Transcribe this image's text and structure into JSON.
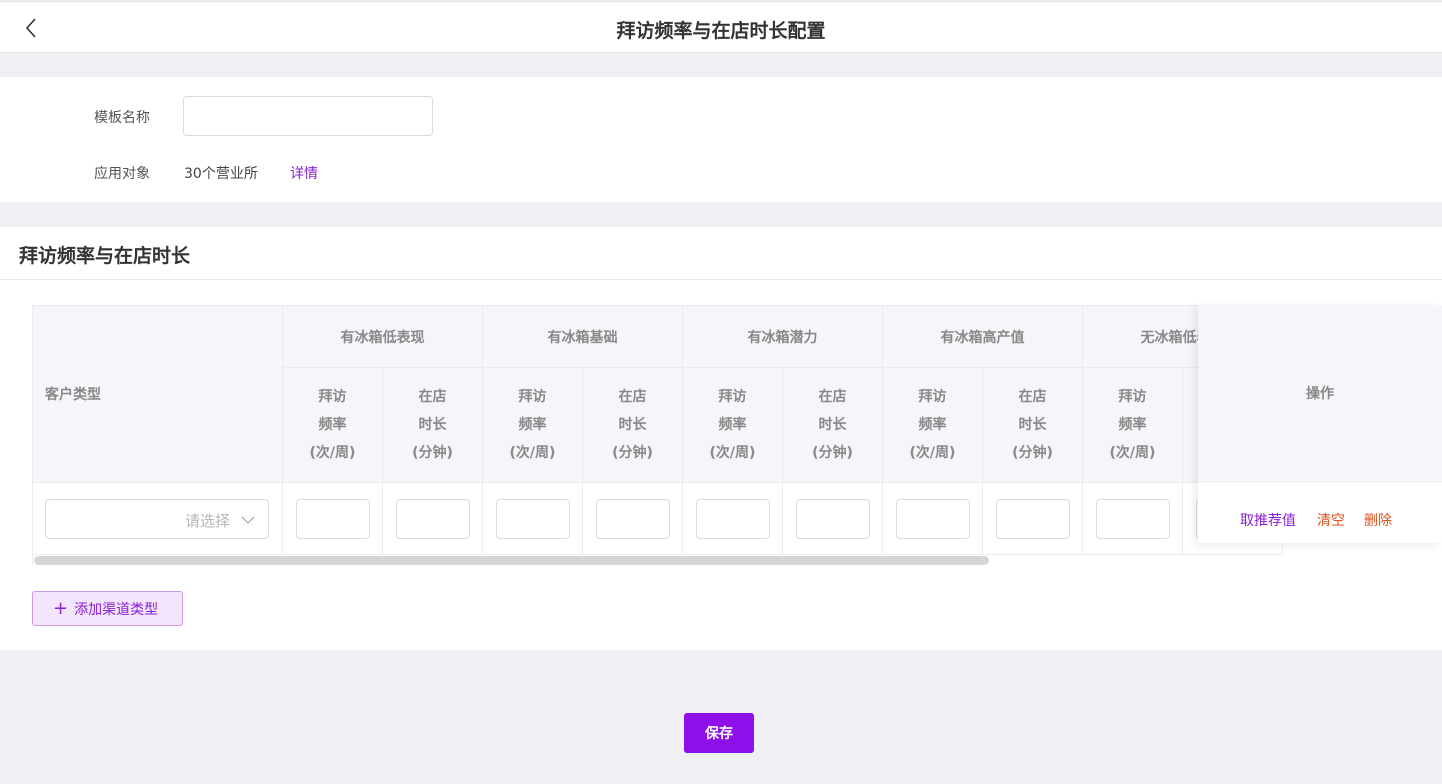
{
  "header": {
    "title": "拜访频率与在店时长配置",
    "back_icon": "chevron-left-icon"
  },
  "basic": {
    "template_name_label": "模板名称",
    "template_name_value": "",
    "apply_target_label": "应用对象",
    "apply_target_value": "30个营业所",
    "detail_link": "详情"
  },
  "section": {
    "title": "拜访频率与在店时长"
  },
  "table": {
    "customer_type_header": "客户类型",
    "groups": [
      "有冰箱低表现",
      "有冰箱基础",
      "有冰箱潜力",
      "有冰箱高产值",
      "无冰箱低表现"
    ],
    "sub_freq": [
      "拜访",
      "频率",
      "(次/周)"
    ],
    "sub_dur": [
      "在店",
      "时长",
      "(分钟)"
    ],
    "row": {
      "select_placeholder": "请选择"
    },
    "ops_header": "操作",
    "ops": {
      "recommend": "取推荐值",
      "clear": "清空",
      "delete": "删除"
    }
  },
  "buttons": {
    "add_channel": "添加渠道类型",
    "save": "保存"
  },
  "colors": {
    "accent": "#8f0fe8",
    "link": "#8a1fd6",
    "danger": "#e0511c"
  }
}
